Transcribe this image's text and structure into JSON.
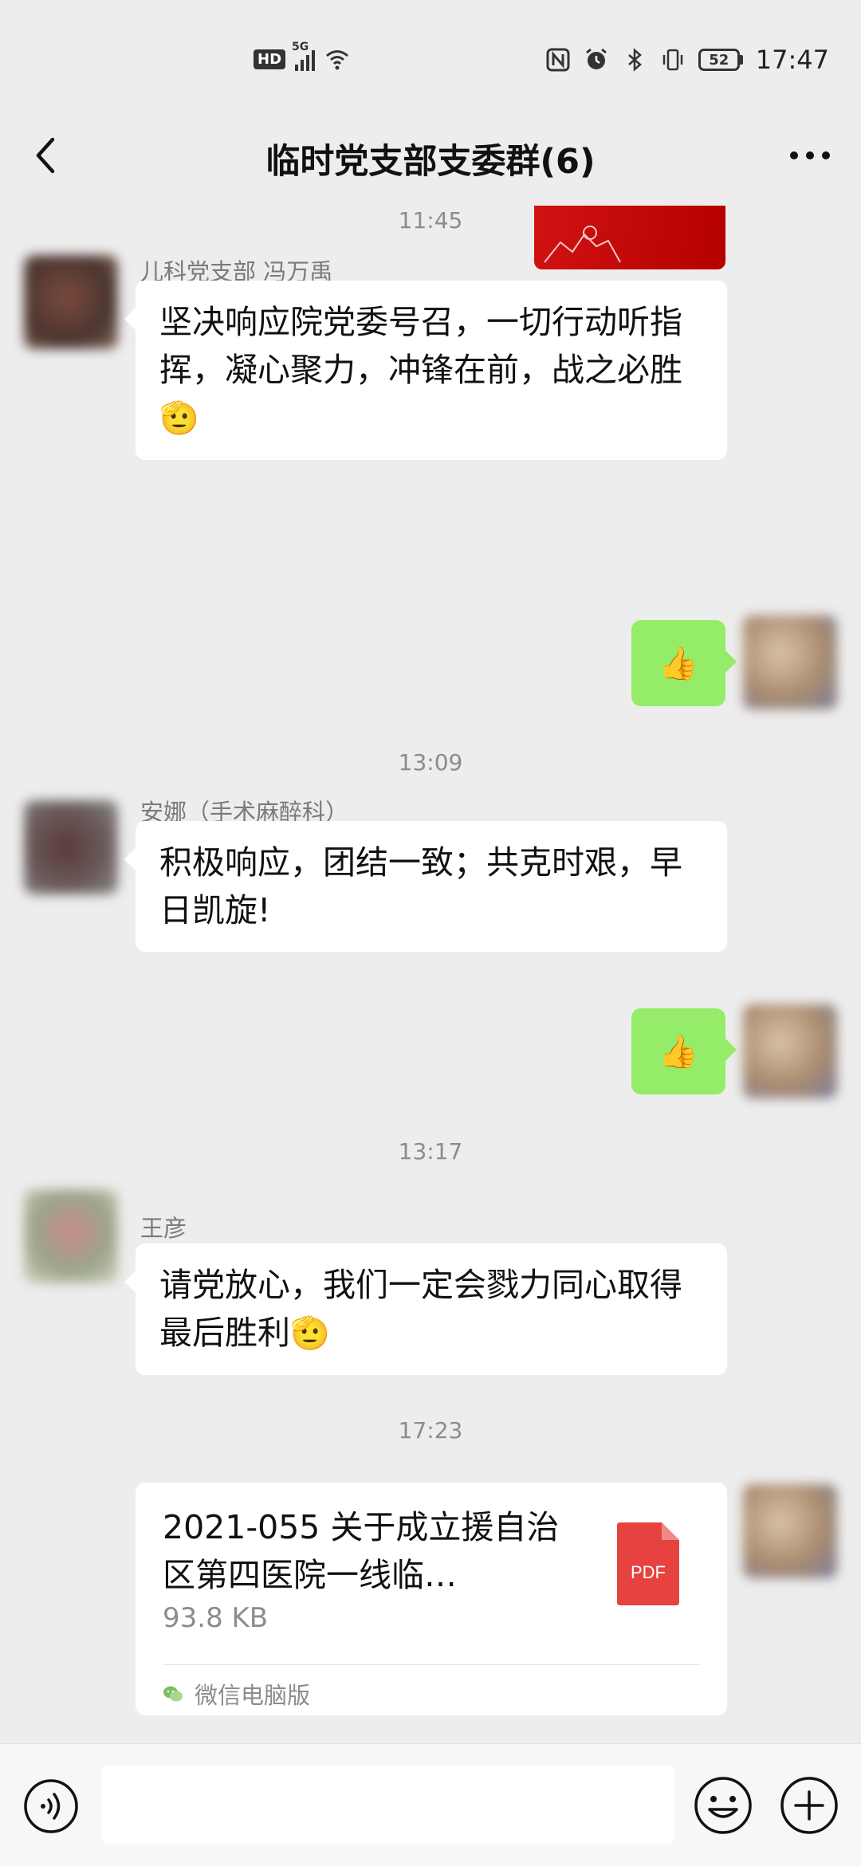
{
  "status": {
    "hd": "HD",
    "net": "5G",
    "battery": "52",
    "time": "17:47"
  },
  "header": {
    "title": "临时党支部支委群(6)"
  },
  "chat": {
    "times": [
      "11:45",
      "13:09",
      "13:17",
      "17:23"
    ],
    "messages": [
      {
        "sender": "儿科党支部  冯万禹",
        "text": "坚决响应院党委号召，一切行动听指挥，凝心聚力，冲锋在前，战之必胜",
        "emoji": "🫡"
      },
      {
        "outgoing": "👍"
      },
      {
        "sender": "安娜（手术麻醉科）",
        "text": "积极响应，团结一致；共克时艰，早日凯旋!"
      },
      {
        "outgoing": "👍"
      },
      {
        "sender": "王彦",
        "text": "请党放心，我们一定会戮力同心取得最后胜利",
        "emoji": "🫡"
      }
    ],
    "file": {
      "name": "2021-055 关于成立援自治区第四医院一线临…",
      "size": "93.8 KB",
      "type": "PDF",
      "source": "微信电脑版"
    }
  },
  "colors": {
    "background": "#ededed",
    "outgoing_bubble": "#95ec69",
    "incoming_bubble": "#ffffff",
    "pdf_red": "#e64340"
  }
}
